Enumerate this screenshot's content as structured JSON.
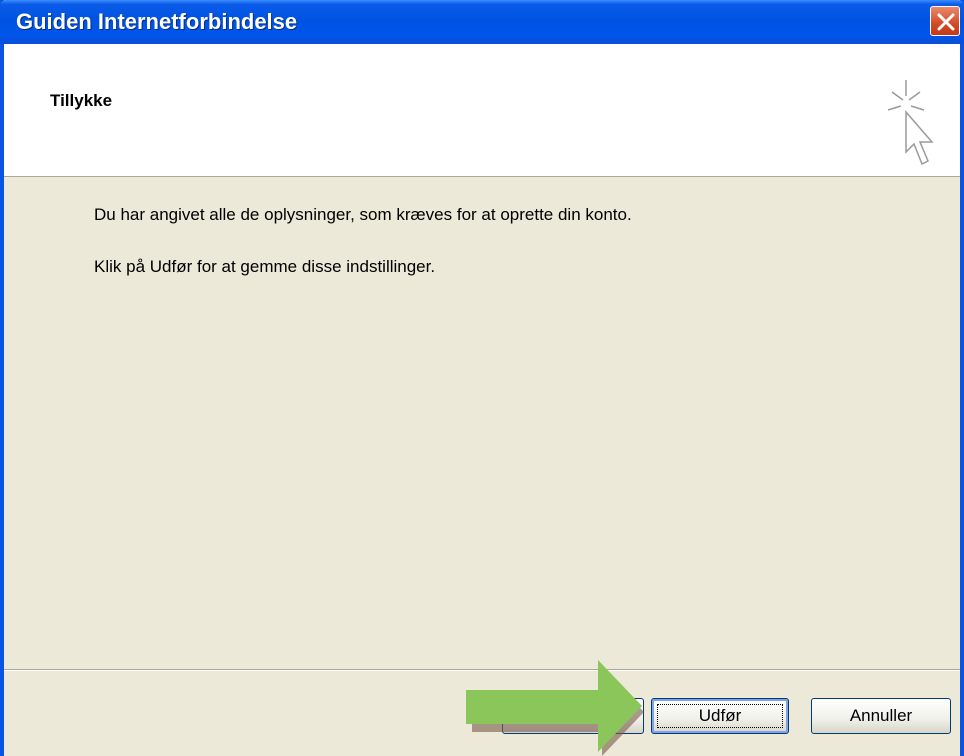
{
  "window": {
    "title": "Guiden Internetforbindelse",
    "close_icon": "close-icon"
  },
  "header": {
    "title": "Tillykke",
    "icon": "wizard-cursor-icon"
  },
  "content": {
    "line1": "Du har angivet alle de oplysninger, som kræves for at oprette din konto.",
    "line2": "Klik på Udfør for at gemme disse indstillinger."
  },
  "buttons": {
    "finish_label": "Udfør",
    "cancel_label": "Annuller"
  },
  "annotation": {
    "arrow_icon": "green-arrow-icon",
    "color": "#8BC65A"
  }
}
